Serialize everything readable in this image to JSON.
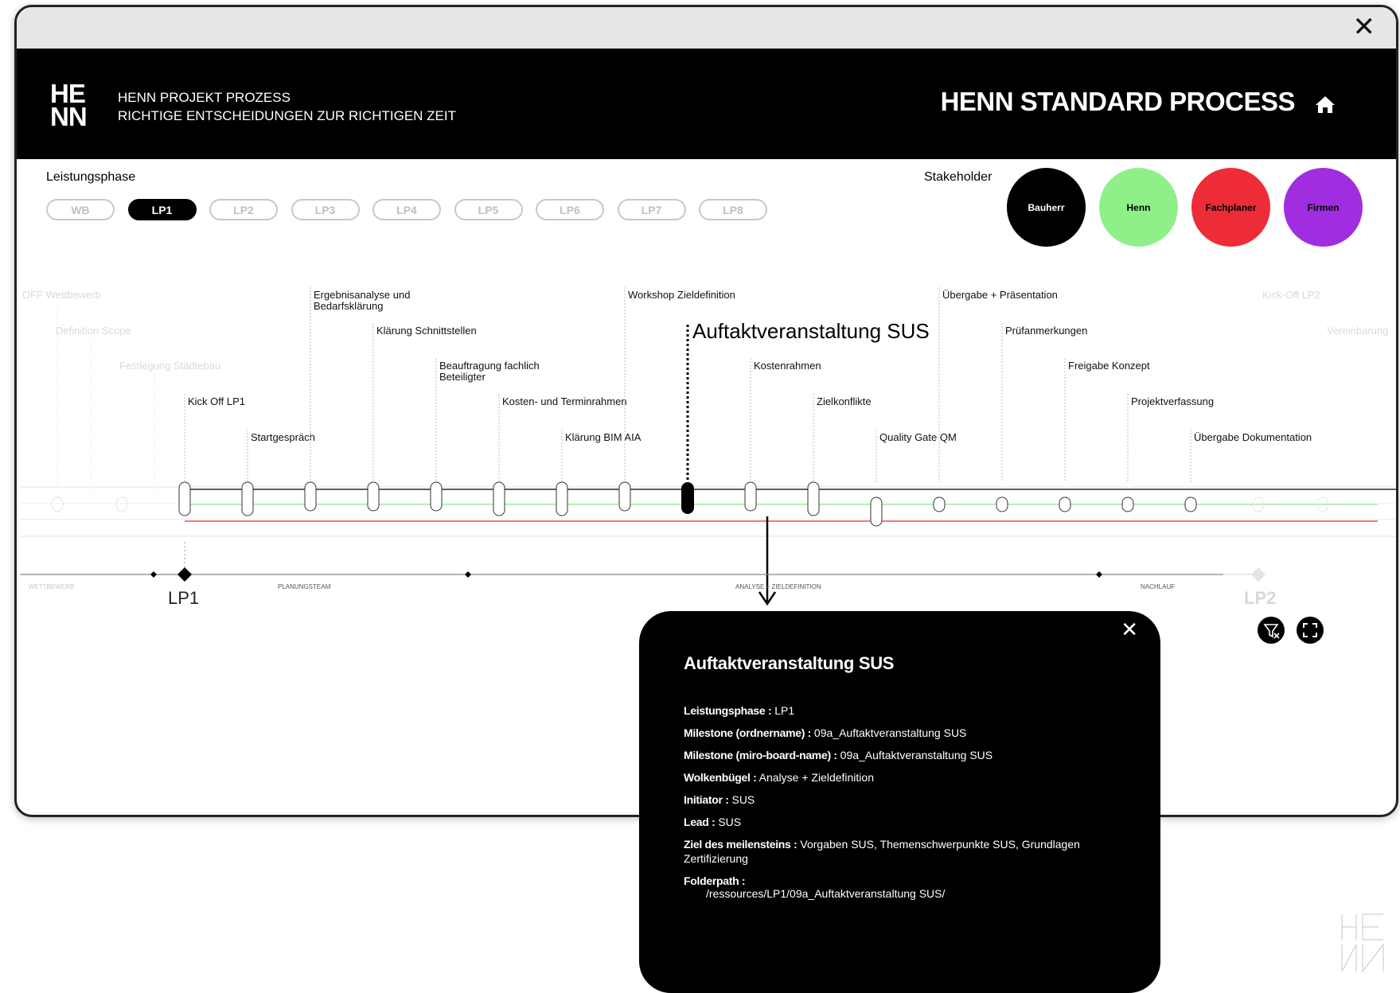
{
  "window": {
    "close_label": "✕"
  },
  "header": {
    "logo_line1": "HE",
    "logo_line2": "NN",
    "subtitle_line1": "HENN PROJEKT PROZESS",
    "subtitle_line2": "RICHTIGE ENTSCHEIDUNGEN ZUR RICHTIGEN ZEIT",
    "title": "HENN STANDARD PROCESS",
    "home_icon": "home-icon"
  },
  "leistungsphase": {
    "label": "Leistungsphase",
    "phases": [
      "WB",
      "LP1",
      "LP2",
      "LP3",
      "LP4",
      "LP5",
      "LP6",
      "LP7",
      "LP8"
    ],
    "active": "LP1"
  },
  "stakeholder": {
    "label": "Stakeholder",
    "items": [
      {
        "label": "Bauherr",
        "color": "#000000",
        "text_color": "#ffffff"
      },
      {
        "label": "Henn",
        "color": "#8ff08a",
        "text_color": "#000000"
      },
      {
        "label": "Fachplaner",
        "color": "#ee2c38",
        "text_color": "#000000"
      },
      {
        "label": "Firmen",
        "color": "#a02ee0",
        "text_color": "#000000"
      }
    ]
  },
  "timeline": {
    "faded_milestones_left": [
      "OFF Wettbewerb",
      "Definition Scope",
      "Festlegung Städtebau"
    ],
    "faded_milestones_right": [
      "Kick-Off LP2",
      "Vereinbarung"
    ],
    "milestones": [
      {
        "label": "Kick Off LP1",
        "level": 3
      },
      {
        "label": "Startgespräch",
        "level": 4
      },
      {
        "label": "Ergebnisanalyse und",
        "label2": "Bedarfsklärung",
        "level": 0
      },
      {
        "label": "Klärung Schnittstellen",
        "level": 1
      },
      {
        "label": "Beauftragung fachlich",
        "label2": "Beteiligter",
        "level": 2
      },
      {
        "label": "Kosten- und Terminrahmen",
        "level": 3
      },
      {
        "label": "Klärung BIM AIA",
        "level": 4
      },
      {
        "label": "Workshop Zieldefinition",
        "level": 0
      },
      {
        "label": "Auftaktveranstaltung SUS",
        "level": 1,
        "selected": true
      },
      {
        "label": "Kostenrahmen",
        "level": 2
      },
      {
        "label": "Zielkonflikte",
        "level": 3
      },
      {
        "label": "Quality Gate QM",
        "level": 4
      },
      {
        "label": "Übergabe + Präsentation",
        "level": 0
      },
      {
        "label": "Prüfanmerkungen",
        "level": 1
      },
      {
        "label": "Freigabe Konzept",
        "level": 2
      },
      {
        "label": "Projektverfassung",
        "level": 3
      },
      {
        "label": "Übergabe Dokumentation",
        "level": 4
      }
    ],
    "phase_bar_labels": [
      "WETTBEWERB",
      "PLANUNGSTEAM",
      "ANALYSE + ZIELDEFINITION",
      "NACHLAUF"
    ],
    "lp_current": "LP1",
    "lp_next": "LP2",
    "line_colors": {
      "bauherr": "#000000",
      "henn": "#8ff08a",
      "fachplaner": "#ee2c38"
    }
  },
  "tools": {
    "filter_icon": "filter-clear-icon",
    "fullscreen_icon": "fullscreen-icon"
  },
  "popup": {
    "close_label": "✕",
    "title": "Auftaktveranstaltung SUS",
    "rows": [
      {
        "key": "Leistungsphase :",
        "value": "LP1"
      },
      {
        "key": "Milestone (ordnername) :",
        "value": "09a_Auftaktveranstaltung SUS"
      },
      {
        "key": "Milestone (miro-board-name) :",
        "value": "09a_Auftaktveranstaltung SUS"
      },
      {
        "key": "Wolkenbügel :",
        "value": "Analyse + Zieldefinition"
      },
      {
        "key": "Initiator :",
        "value": "SUS"
      },
      {
        "key": "Lead :",
        "value": "SUS"
      },
      {
        "key": "Ziel des meilensteins :",
        "value": "Vorgaben SUS, Themenschwerpunkte SUS, Grundlagen Zertifizierung"
      },
      {
        "key": "Folderpath :",
        "value": "/ressources/LP1/09a_Auftaktveranstaltung SUS/"
      }
    ]
  }
}
